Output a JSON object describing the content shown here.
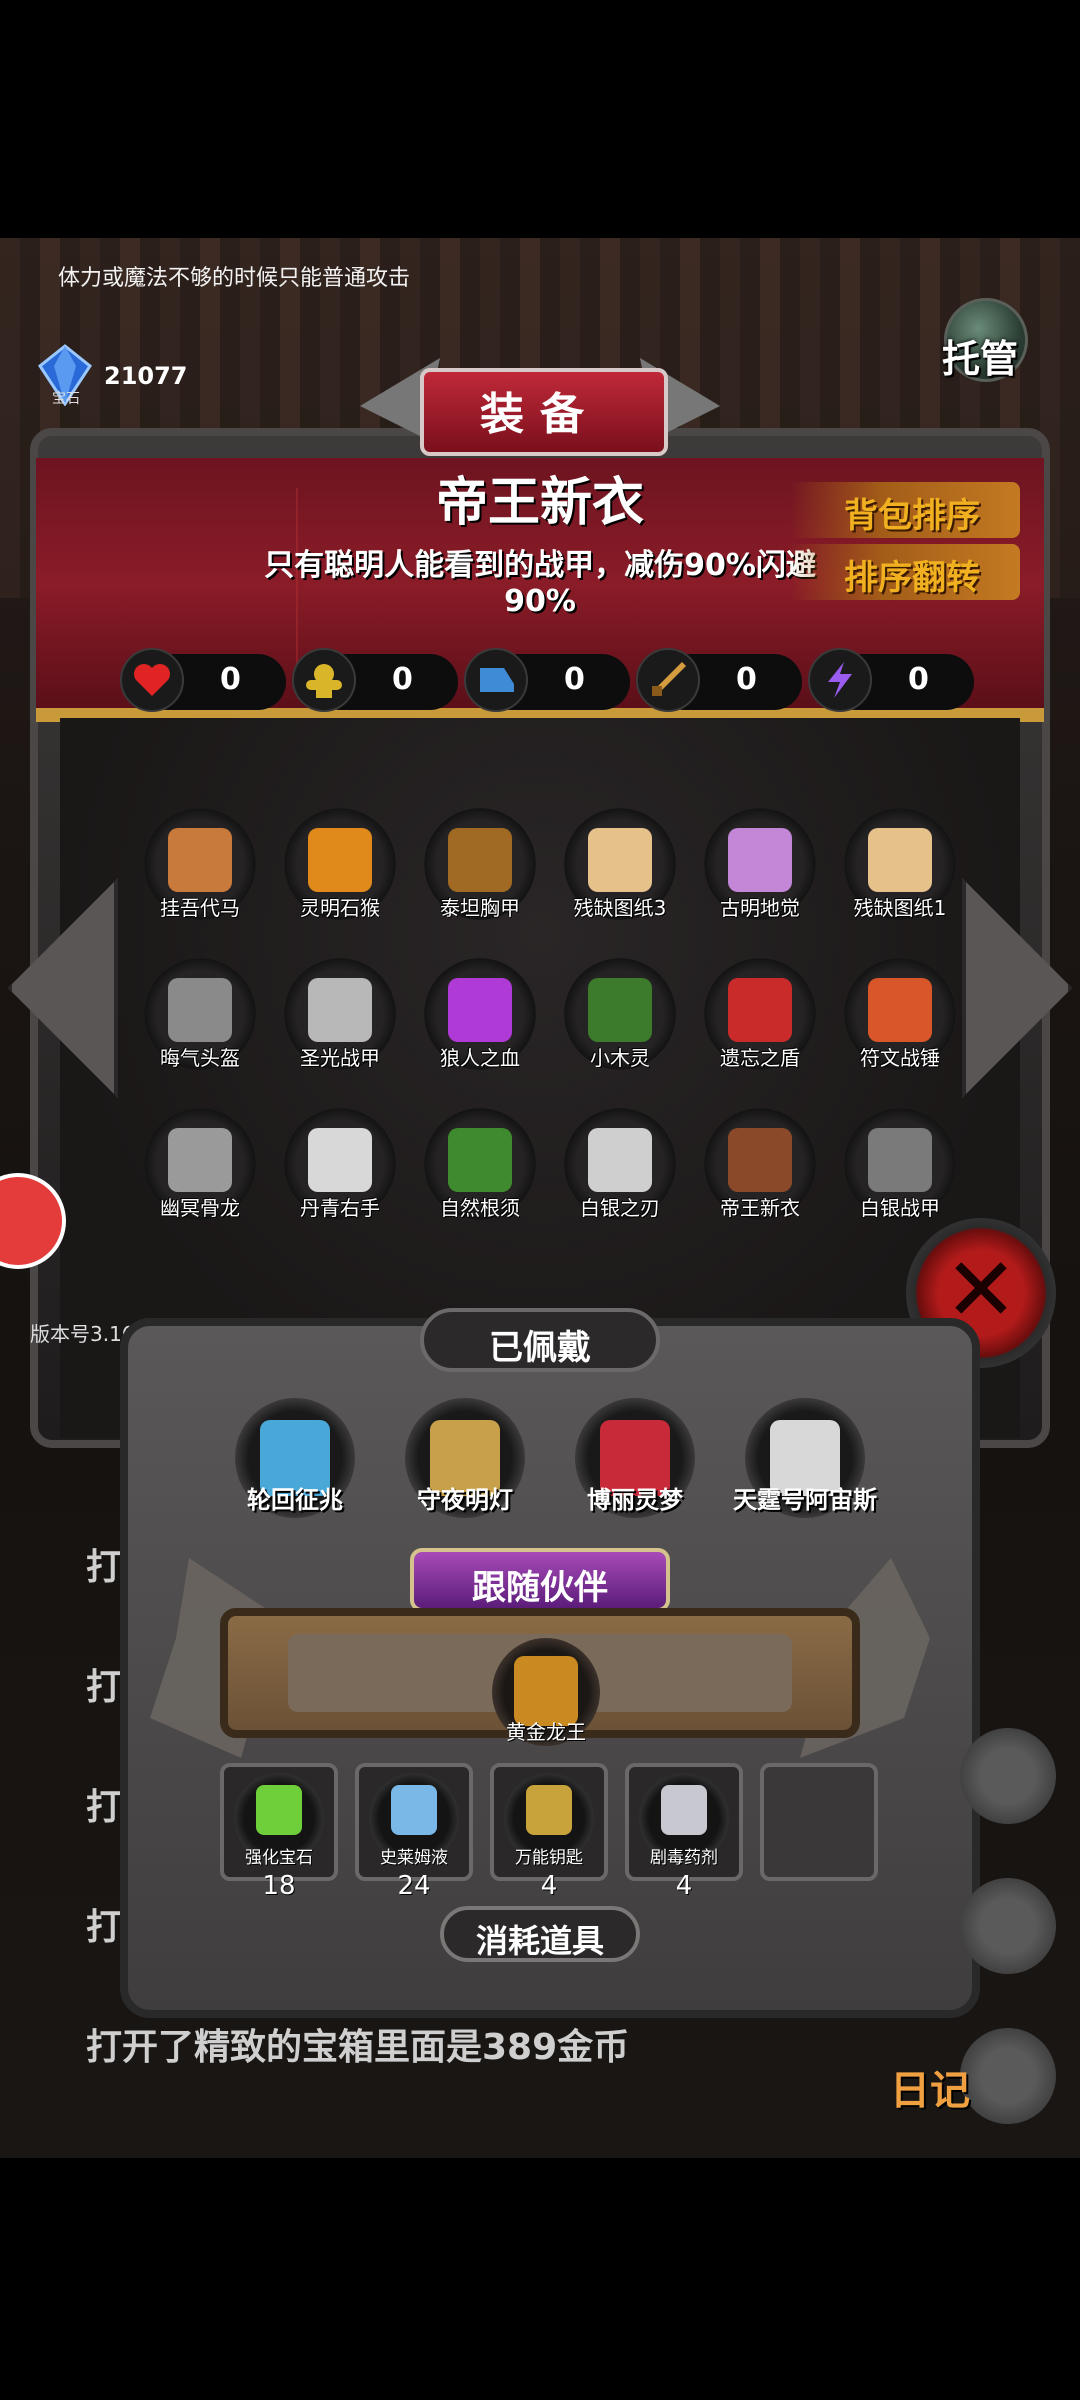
{
  "hud": {
    "hint": "体力或魔法不够的时候只能普通攻击",
    "gem_count": "21077",
    "gem_label": "宝石",
    "auto_label": "托管",
    "version": "版本号3.16"
  },
  "equipment": {
    "title": "装备",
    "item_name": "帝王新衣",
    "item_desc": "只有聪明人能看到的战甲，减伤90%闪避90%",
    "sort_button": "背包排序",
    "reverse_button": "排序翻转",
    "stats": [
      {
        "icon": "heart-icon",
        "value": "0",
        "color": "#e02424"
      },
      {
        "icon": "strength-icon",
        "value": "0",
        "color": "#d9b52a"
      },
      {
        "icon": "boot-icon",
        "value": "0",
        "color": "#3f8bd6"
      },
      {
        "icon": "sword-icon",
        "value": "0",
        "color": "#d69c3f"
      },
      {
        "icon": "lightning-icon",
        "value": "0",
        "color": "#9b5cf0"
      }
    ],
    "items": [
      {
        "name": "挂吾代马",
        "color": "#c77a3b"
      },
      {
        "name": "灵明石猴",
        "color": "#e08a1c"
      },
      {
        "name": "泰坦胸甲",
        "color": "#a16a24"
      },
      {
        "name": "残缺图纸3",
        "color": "#e6c28a"
      },
      {
        "name": "古明地觉",
        "color": "#c486d6"
      },
      {
        "name": "残缺图纸1",
        "color": "#e6c28a"
      },
      {
        "name": "晦气头盔",
        "color": "#8a8a8a"
      },
      {
        "name": "圣光战甲",
        "color": "#b8b8b8"
      },
      {
        "name": "狼人之血",
        "color": "#b03ad6"
      },
      {
        "name": "小木灵",
        "color": "#3c7a2c"
      },
      {
        "name": "遗忘之盾",
        "color": "#c92a2a"
      },
      {
        "name": "符文战锤",
        "color": "#d8562a"
      },
      {
        "name": "幽冥骨龙",
        "color": "#9a9a9a"
      },
      {
        "name": "丹青右手",
        "color": "#d8d8d8"
      },
      {
        "name": "自然根须",
        "color": "#3f8a2e"
      },
      {
        "name": "白银之刃",
        "color": "#cfcfcf"
      },
      {
        "name": "帝王新衣",
        "color": "#8a4a2a"
      },
      {
        "name": "白银战甲",
        "color": "#7a7a7a"
      }
    ]
  },
  "worn": {
    "title": "已佩戴",
    "items": [
      {
        "name": "轮回征兆",
        "color": "#4aa8d8"
      },
      {
        "name": "守夜明灯",
        "color": "#c8a04a"
      },
      {
        "name": "博丽灵梦",
        "color": "#c82a3a"
      },
      {
        "name": "天霆号阿宙斯",
        "color": "#d8d8d8"
      }
    ]
  },
  "partner": {
    "title": "跟随伙伴",
    "name": "黄金龙王"
  },
  "consumables": {
    "title": "消耗道具",
    "items": [
      {
        "name": "强化宝石",
        "count": "18",
        "color": "#6fcf3a"
      },
      {
        "name": "史莱姆液",
        "count": "24",
        "color": "#7ab8e8"
      },
      {
        "name": "万能钥匙",
        "count": "4",
        "color": "#c8a23a"
      },
      {
        "name": "剧毒药剂",
        "count": "4",
        "color": "#c8c8d0"
      }
    ]
  },
  "log": {
    "line1": "打",
    "line2": "打",
    "line3": "打",
    "line4": "打",
    "last": "打开了精致的宝箱里面是389金币",
    "diary": "日记"
  }
}
